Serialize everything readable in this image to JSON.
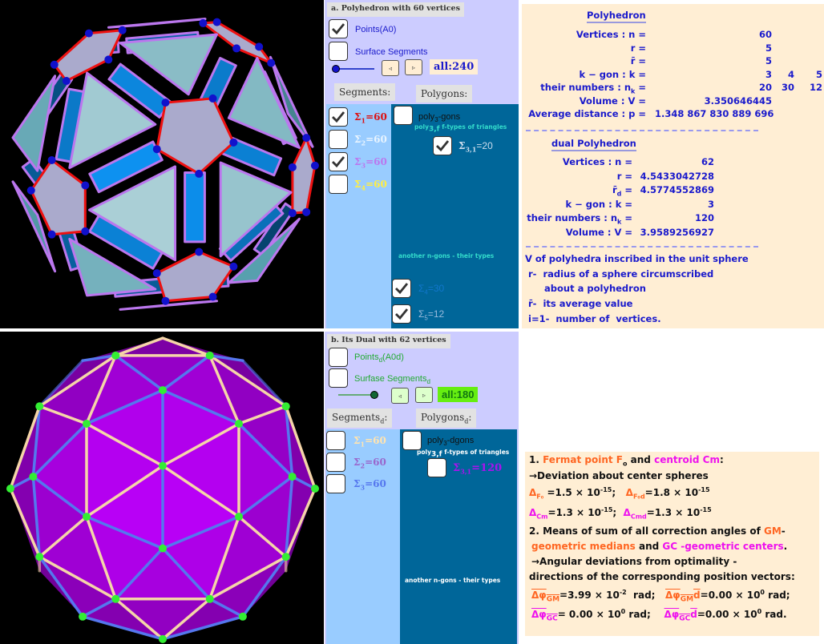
{
  "views": {
    "a": {
      "title": "Polyhedron with 60 vertices (3D view)",
      "face_color": "#8fc4cc",
      "band_color": "#0088dd",
      "edge_color_1": "#ee1111",
      "edge_color_3": "#bb77ee",
      "vertex_color": "#1111cc"
    },
    "b": {
      "title": "Dual with 62 vertices (3D view)",
      "face_color": "#aa00ee",
      "edge_color_1": "#f5d5a8",
      "edge_color_2": "#5577ee",
      "vertex_color": "#33ee33"
    }
  },
  "panel_a": {
    "title": "a. Polyhedron with 60 vertices",
    "points_label": "Points(A0)",
    "points_checked": true,
    "surface_label": "Surface Segments",
    "surface_checked": false,
    "step_back": "◃",
    "step_fwd": "▹",
    "all_label": "all:240",
    "slider_value": 0,
    "segments_header": "Segments:",
    "polygons_header": "Polygons:",
    "segments": [
      {
        "label": "Σ",
        "sub": "1",
        "value": "=60",
        "checked": true,
        "color": "#dd1111"
      },
      {
        "label": "Σ",
        "sub": "2",
        "value": "=60",
        "checked": false,
        "color": "#e8f4ff"
      },
      {
        "label": "Σ",
        "sub": "3",
        "value": "=60",
        "checked": true,
        "color": "#bb77ee"
      },
      {
        "label": "Σ",
        "sub": "4",
        "value": "=60",
        "checked": false,
        "color": "#ffee44"
      }
    ],
    "polygons": {
      "polyk_label": "poly",
      "polyk_sub": "3",
      "polyk_suffix": "-gons",
      "polyk_checked": false,
      "ftypes_prefix": "poly",
      "ftypes_sub": "3,f",
      "ftypes_suffix": "f-types of triangles",
      "sigma31": {
        "label": "Σ",
        "sub": "3,1",
        "value": "=20",
        "checked": true,
        "color": "#ccddee"
      },
      "another_label": "another n-gons -  their types",
      "others": [
        {
          "label": "Σ",
          "sub": "4",
          "value": "=30",
          "checked": true,
          "color": "#1177cc"
        },
        {
          "label": "Σ",
          "sub": "5",
          "value": "=12",
          "checked": true,
          "color": "#99bbdd"
        }
      ]
    }
  },
  "panel_b": {
    "title": "b. Its Dual with 62  vertices",
    "points_label": "Points",
    "points_sub": "d",
    "points_suffix": "(A0d)",
    "points_checked": false,
    "surface_label": "Surfase Segments",
    "surface_sub": "d",
    "surface_checked": false,
    "step_back": "◃",
    "step_fwd": "▹",
    "all_label": "all:180",
    "slider_value": 1,
    "segments_header": "Segments",
    "segments_header_sub": "d",
    "segments_header_suffix": ":",
    "polygons_header": "Polygons",
    "polygons_header_sub": "d",
    "polygons_header_suffix": ":",
    "segments": [
      {
        "label": "Σ",
        "sub": "1",
        "value": "=60",
        "checked": false,
        "color": "#ffe4b0"
      },
      {
        "label": "Σ",
        "sub": "2",
        "value": "=60",
        "checked": false,
        "color": "#9966cc"
      },
      {
        "label": "Σ",
        "sub": "3",
        "value": "=60",
        "checked": false,
        "color": "#5577ee"
      }
    ],
    "polygons": {
      "polyk_label": "poly",
      "polyk_sub": "3",
      "polyk_suffix": "-dgons",
      "polyk_checked": false,
      "ftypes_prefix": "poly",
      "ftypes_sub": "3,f",
      "ftypes_suffix": "f-types of triangles",
      "sigma31": {
        "label": "Σ",
        "sub": "3,1",
        "value": "=120",
        "checked": false,
        "color": "#aa11ee"
      },
      "another_label": "another n-gons -  their types"
    }
  },
  "info_a": {
    "heading": "Polyhedron",
    "rows": [
      {
        "label": "Vertices : n =",
        "values": [
          "60"
        ]
      },
      {
        "label": "r =",
        "values": [
          "5"
        ]
      },
      {
        "label": "r̄ =",
        "values": [
          "5"
        ]
      },
      {
        "label": "k − gon : k =",
        "values": [
          "3",
          "4",
          "5"
        ]
      },
      {
        "label": "their numbers : n",
        "label_sub": "k",
        "label_suffix": " =",
        "values": [
          "20",
          "30",
          "12"
        ]
      },
      {
        "label": "Volume : V =",
        "values": [
          "3.350646445"
        ]
      },
      {
        "label": "Average distance : p =",
        "values": [
          "1.348 867 830 889 696"
        ]
      }
    ],
    "dual_heading": "dual Polyhedron",
    "dual_rows": [
      {
        "label": "Vertices : n =",
        "value": "62"
      },
      {
        "label": "r =",
        "value": "4.5433042728"
      },
      {
        "label": "r̄",
        "label_sub": "d",
        "label_suffix": " =",
        "value": "4.5774552869"
      },
      {
        "label": "k − gon : k =",
        "value": "3"
      },
      {
        "label": "their numbers : n",
        "label_sub": "k",
        "label_suffix": " =",
        "value": "120"
      },
      {
        "label": "Volume : V =",
        "value": "3.9589256927"
      }
    ],
    "notes": [
      "V of polyhedra inscribed in the unit sphere",
      " r-  radius of a sphere circumscribed",
      "      about a polyhedron",
      " r̄-  its average value",
      " i=1-  number of  vertices."
    ]
  },
  "info_b": {
    "l1_num": "1. ",
    "l1_fermat": "Fermat point  F",
    "l1_fermat_sub": "o",
    "l1_and": " and  ",
    "l1_centroid": "centroid Cm",
    "l1_colon": ":",
    "l2": "→Deviation about center spheres",
    "d_f0_label": "Δ",
    "d_f0_sub": "F₀",
    "d_f0_value": " =1.5 × 10",
    "d_f0_exp": "-15",
    "d_f0d_label": "Δ",
    "d_f0d_sub": "F₀d",
    "d_f0d_value": "=1.8 × 10",
    "d_f0d_exp": "-15",
    "d_cm_label": "Δ",
    "d_cm_sub": "Cm",
    "d_cm_value": "=1.3 × 10",
    "d_cm_exp": "-15",
    "d_cmd_label": "Δ",
    "d_cmd_sub": "Cmd",
    "d_cmd_value": "=1.3 × 10",
    "d_cmd_exp": "-15",
    "l5_a": "2. Means of sum of all correction angles of ",
    "l5_gm": "GM",
    "l5_b": "-",
    "l6_gm": "geometric medians",
    "l6_and": " and ",
    "l6_gc": "GC",
    "l6_gc2": " -geometric centers",
    "l6_end": ".",
    "l7": "→Angular deviations from optimality -",
    "l8": "directions of the corresponding position vectors:",
    "phi_gm_label": "Δφ",
    "phi_gm_sub": "GM",
    "phi_gm_value": "=3.99 × 10",
    "phi_gm_exp": "-2",
    "phi_gm_unit": "  rad;  ",
    "phi_gmd_label": "Δφ",
    "phi_gmd_sub": "GM",
    "phi_gmd_d": "d",
    "phi_gmd_value": "=0.00 × 10",
    "phi_gmd_exp": "0",
    "phi_gmd_unit": " rad;",
    "phi_gc_label": "Δφ",
    "phi_gc_sub": "GC",
    "phi_gc_value": "= 0.00 × 10",
    "phi_gc_exp": "0",
    "phi_gc_unit": " rad;   ",
    "phi_gcd_label": "Δφ",
    "phi_gcd_sub": "GC",
    "phi_gcd_d": "d",
    "phi_gcd_value": "=0.00 × 10",
    "phi_gcd_exp": "0",
    "phi_gcd_unit": " rad."
  }
}
